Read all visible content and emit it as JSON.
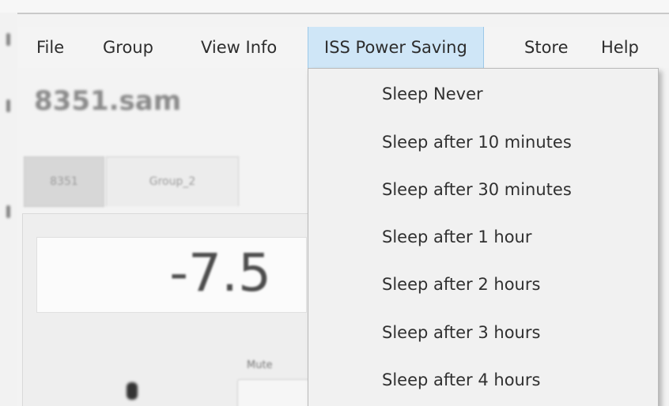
{
  "menubar": {
    "items": [
      {
        "label": "File"
      },
      {
        "label": "Group"
      },
      {
        "label": "View Info"
      },
      {
        "label": "ISS Power Saving"
      },
      {
        "label": "Store"
      },
      {
        "label": "Help"
      }
    ]
  },
  "background": {
    "title": "8351.sam",
    "tabs": [
      {
        "label": "8351"
      },
      {
        "label": "Group_2"
      }
    ],
    "value": "-7.5",
    "mute_label": "Mute"
  },
  "dropdown": {
    "menu": "ISS Power Saving",
    "items": [
      {
        "label": "Sleep Never"
      },
      {
        "label": "Sleep after 10 minutes"
      },
      {
        "label": "Sleep after 30 minutes"
      },
      {
        "label": "Sleep after 1 hour"
      },
      {
        "label": "Sleep after 2 hours"
      },
      {
        "label": "Sleep after 3 hours"
      },
      {
        "label": "Sleep after 4 hours"
      }
    ]
  },
  "colors": {
    "menu_active_bg": "#cfe6f7",
    "menu_active_border": "#9cc8e8",
    "dropdown_bg": "#f1f1f1"
  }
}
